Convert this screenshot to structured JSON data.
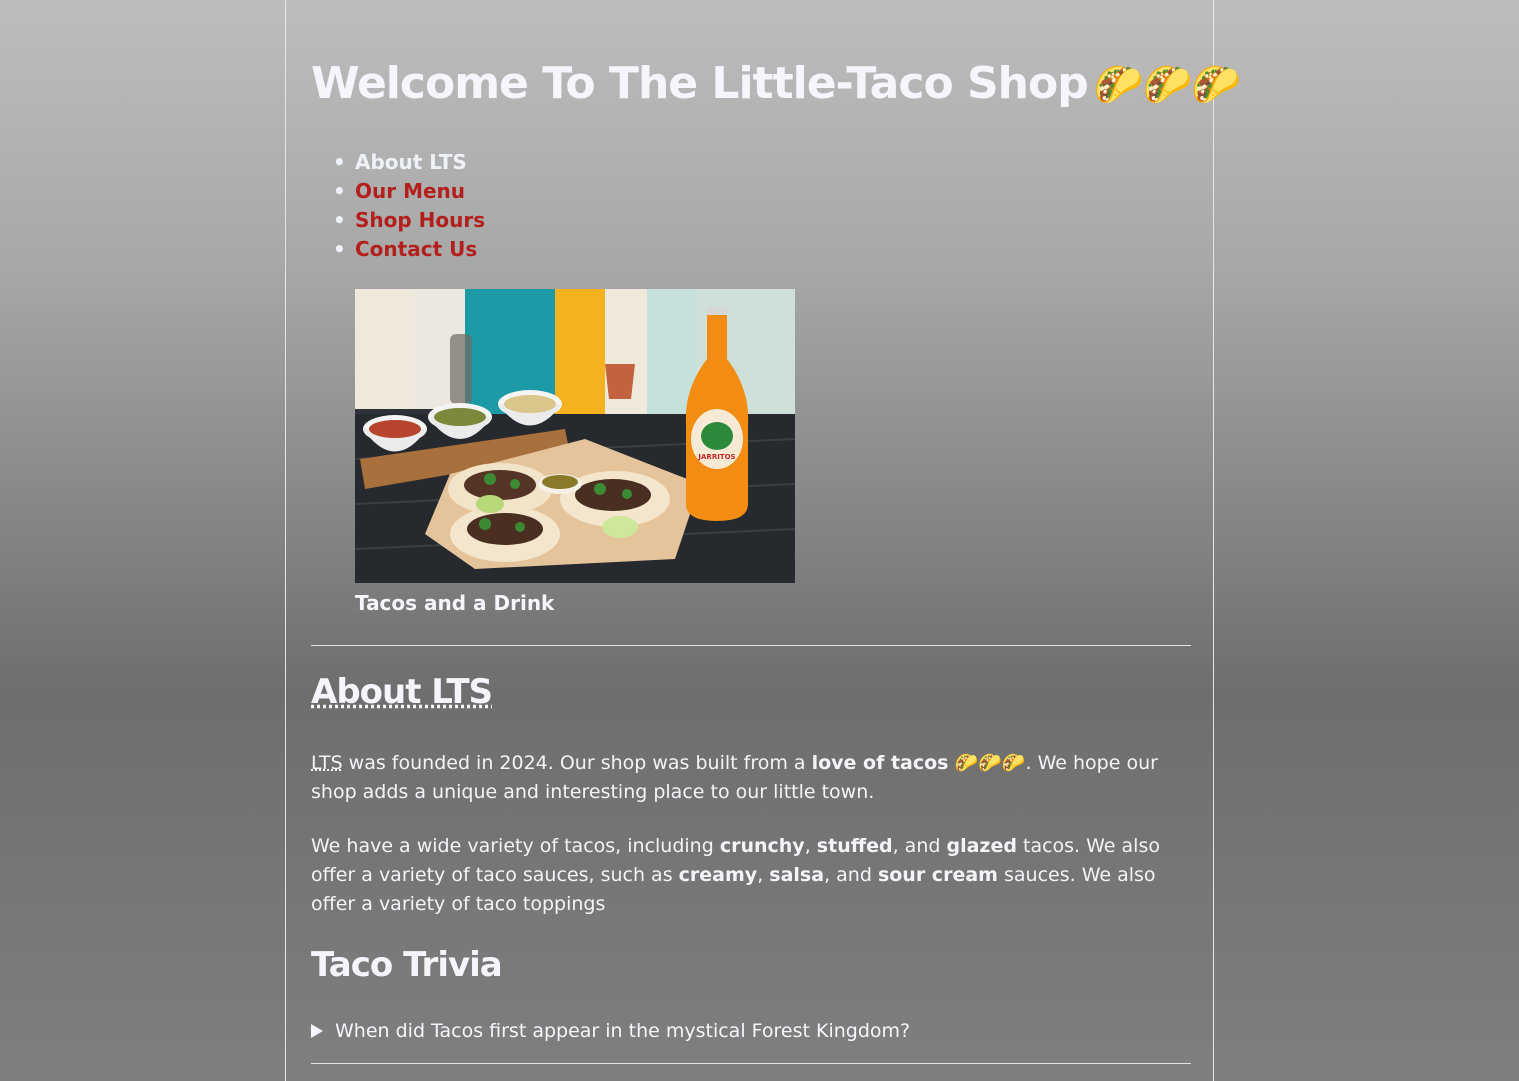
{
  "header": {
    "title": "Welcome To The Little-Taco Shop",
    "title_emojis": "🌮🌮🌮"
  },
  "nav": {
    "items": [
      {
        "label": "About LTS"
      },
      {
        "label": "Our Menu"
      },
      {
        "label": "Shop Hours"
      },
      {
        "label": "Contact Us"
      }
    ]
  },
  "figure": {
    "caption": "Tacos and a Drink",
    "bottle_label": "JARRITOS"
  },
  "about": {
    "heading": "About LTS",
    "p1_abbr": "LTS",
    "p1_text_a": " was founded in 2024. Our shop was built from a ",
    "p1_bold": "love of tacos",
    "p1_emojis": " 🌮🌮🌮",
    "p1_text_b": ". We hope our shop adds a unique and interesting place to our little town.",
    "p2_text_a": "We have a wide variety of tacos, including ",
    "p2_b1": "crunchy",
    "p2_sep1": ", ",
    "p2_b2": "stuffed",
    "p2_text_b": ", and ",
    "p2_b3": "glazed",
    "p2_text_c": " tacos. We also offer a variety of taco sauces, such as ",
    "p2_b4": "creamy",
    "p2_sep2": ", ",
    "p2_b5": "salsa",
    "p2_text_d": ", and ",
    "p2_b6": "sour cream",
    "p2_text_e": " sauces. We also offer a variety of taco toppings"
  },
  "trivia": {
    "heading": "Taco Trivia",
    "question": "When did Tacos first appear in the mystical Forest Kingdom?"
  },
  "colors": {
    "link": "#b3201c",
    "text": "#f2f4f8"
  }
}
